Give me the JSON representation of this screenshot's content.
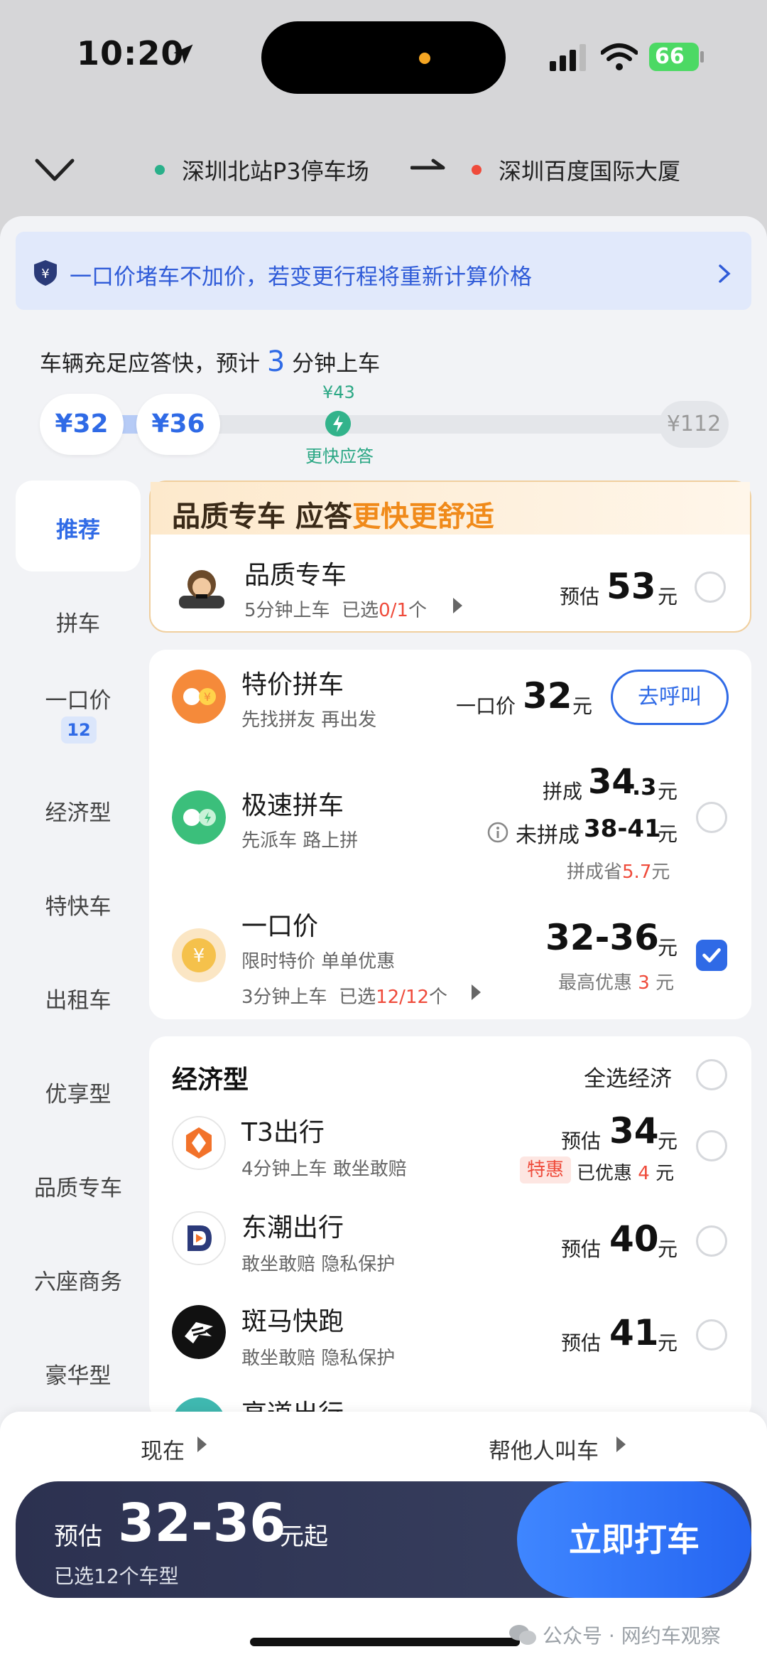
{
  "status_bar": {
    "time": "10:20",
    "battery": "66"
  },
  "route": {
    "origin": "深圳北站P3停车场",
    "destination": "深圳百度国际大厦"
  },
  "notice": {
    "text": "一口价堵车不加价，若变更行程将重新计算价格"
  },
  "eta": {
    "prefix": "车辆充足应答快，预计",
    "minutes": "3",
    "suffix": "分钟上车"
  },
  "price_slider": {
    "pill1": "¥32",
    "pill2": "¥36",
    "max": "¥112",
    "fast_price": "¥43",
    "fast_label": "更快应答"
  },
  "nav": [
    {
      "label": "推荐"
    },
    {
      "label": "拼车"
    },
    {
      "label": "一口价",
      "badge": "12"
    },
    {
      "label": "经济型"
    },
    {
      "label": "特快车"
    },
    {
      "label": "出租车"
    },
    {
      "label": "优享型"
    },
    {
      "label": "品质专车"
    },
    {
      "label": "六座商务"
    },
    {
      "label": "豪华型"
    }
  ],
  "premium": {
    "banner_a": "品质专车 应答",
    "banner_b": "更快更舒适",
    "name": "品质专车",
    "sub_a": "5分钟上车",
    "sub_b": "已选",
    "sub_c": "0/1",
    "sub_d": "个",
    "price_label": "预估",
    "price": "53",
    "unit": "元"
  },
  "carpool": {
    "special": {
      "name": "特价拼车",
      "sub": "先找拼友 再出发",
      "price_label": "一口价",
      "price": "32",
      "unit": "元",
      "button": "去呼叫"
    },
    "express": {
      "name": "极速拼车",
      "sub": "先派车 路上拼",
      "pooled_label": "拼成",
      "pooled_price": "34",
      "pooled_dec": ".3",
      "unit": "元",
      "unpooled_label": "未拼成",
      "unpooled_price": "38-41",
      "save_label": "拼成省",
      "save_value": "5.7"
    },
    "fixed": {
      "name": "一口价",
      "sub": "限时特价 单单优惠",
      "sub2_a": "3分钟上车",
      "sub2_b": "已选",
      "sub2_c": "12/12",
      "sub2_d": "个",
      "price": "32-36",
      "unit": "元",
      "discount_label": "最高优惠",
      "discount_value": "3"
    }
  },
  "economy": {
    "title": "经济型",
    "select_all": "全选经济",
    "items": [
      {
        "name": "T3出行",
        "sub": "4分钟上车 敢坐敢赔",
        "price_label": "预估",
        "price": "34",
        "unit": "元",
        "tag": "特惠",
        "discount_label": "已优惠",
        "discount_value": "4"
      },
      {
        "name": "东潮出行",
        "sub": "敢坐敢赔 隐私保护",
        "price_label": "预估",
        "price": "40",
        "unit": "元"
      },
      {
        "name": "斑马快跑",
        "sub": "敢坐敢赔 隐私保护",
        "price_label": "预估",
        "price": "41",
        "unit": "元"
      },
      {
        "name": "高道出行"
      }
    ]
  },
  "bottom": {
    "option_now": "现在",
    "option_others": "帮他人叫车",
    "est_label": "预估",
    "est_range": "32-36",
    "est_unit": "元起",
    "selected_count": "已选12个车型",
    "cta": "立即打车"
  },
  "watermark": "公众号 · 网约车观察",
  "colors": {
    "accent": "#2f6ae6",
    "premium_accent": "#f08a1a",
    "fast_green": "#32b38b",
    "price_red": "#ef4b3b"
  }
}
